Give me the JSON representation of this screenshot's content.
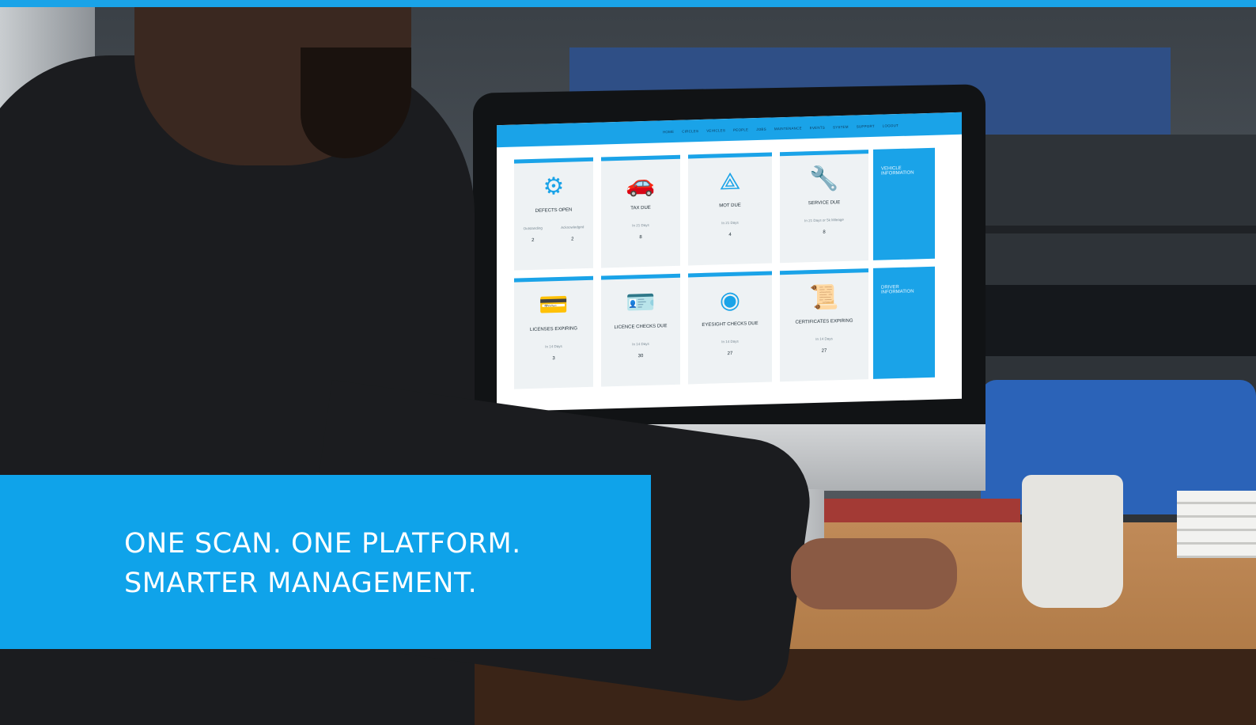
{
  "colors": {
    "brand_blue": "#1aa3e8",
    "banner_blue": "#0fa3ea",
    "tile_bg": "#eef2f4"
  },
  "headline": {
    "line1": "ONE SCAN. ONE PLATFORM.",
    "line2": "SMARTER MANAGEMENT."
  },
  "screen": {
    "nav": [
      "HOME",
      "CIRCLES",
      "VEHICLES",
      "PEOPLE",
      "JOBS",
      "MAINTENANCE",
      "EVENTS",
      "SYSTEM",
      "SUPPORT",
      "LOGOUT"
    ],
    "tiles": [
      {
        "title": "DEFECTS OPEN",
        "icon": "gear-icon",
        "glyph": "⚙",
        "pair": [
          {
            "label": "Outstanding",
            "value": "2"
          },
          {
            "label": "Acknowledged",
            "value": "2"
          }
        ]
      },
      {
        "title": "TAX DUE",
        "icon": "car-icon",
        "glyph": "🚗",
        "sub": "In 21 Days",
        "value": "8"
      },
      {
        "title": "MOT DUE",
        "icon": "mot-triangle-icon",
        "glyph": "⟁",
        "sub": "In 21 Days",
        "value": "4"
      },
      {
        "title": "SERVICE DUE",
        "icon": "service-car-icon",
        "glyph": "🔧",
        "sub": "In 21 Days or 5k Mileage",
        "value": "8"
      },
      {
        "title": "LICENSES EXPIRING",
        "icon": "license-card-icon",
        "glyph": "💳",
        "sub": "In 14 Days",
        "value": "3"
      },
      {
        "title": "LICENCE CHECKS DUE",
        "icon": "id-card-icon",
        "glyph": "🪪",
        "sub": "In 14 Days",
        "value": "30"
      },
      {
        "title": "EYESIGHT CHECKS DUE",
        "icon": "eye-icon",
        "glyph": "◉",
        "sub": "In 14 Days",
        "value": "27"
      },
      {
        "title": "CERTIFICATES EXPIRING",
        "icon": "certificate-icon",
        "glyph": "📜",
        "sub": "In 14 Days",
        "value": "27"
      }
    ],
    "side_panels": [
      "VEHICLE INFORMATION",
      "DRIVER INFORMATION"
    ]
  }
}
